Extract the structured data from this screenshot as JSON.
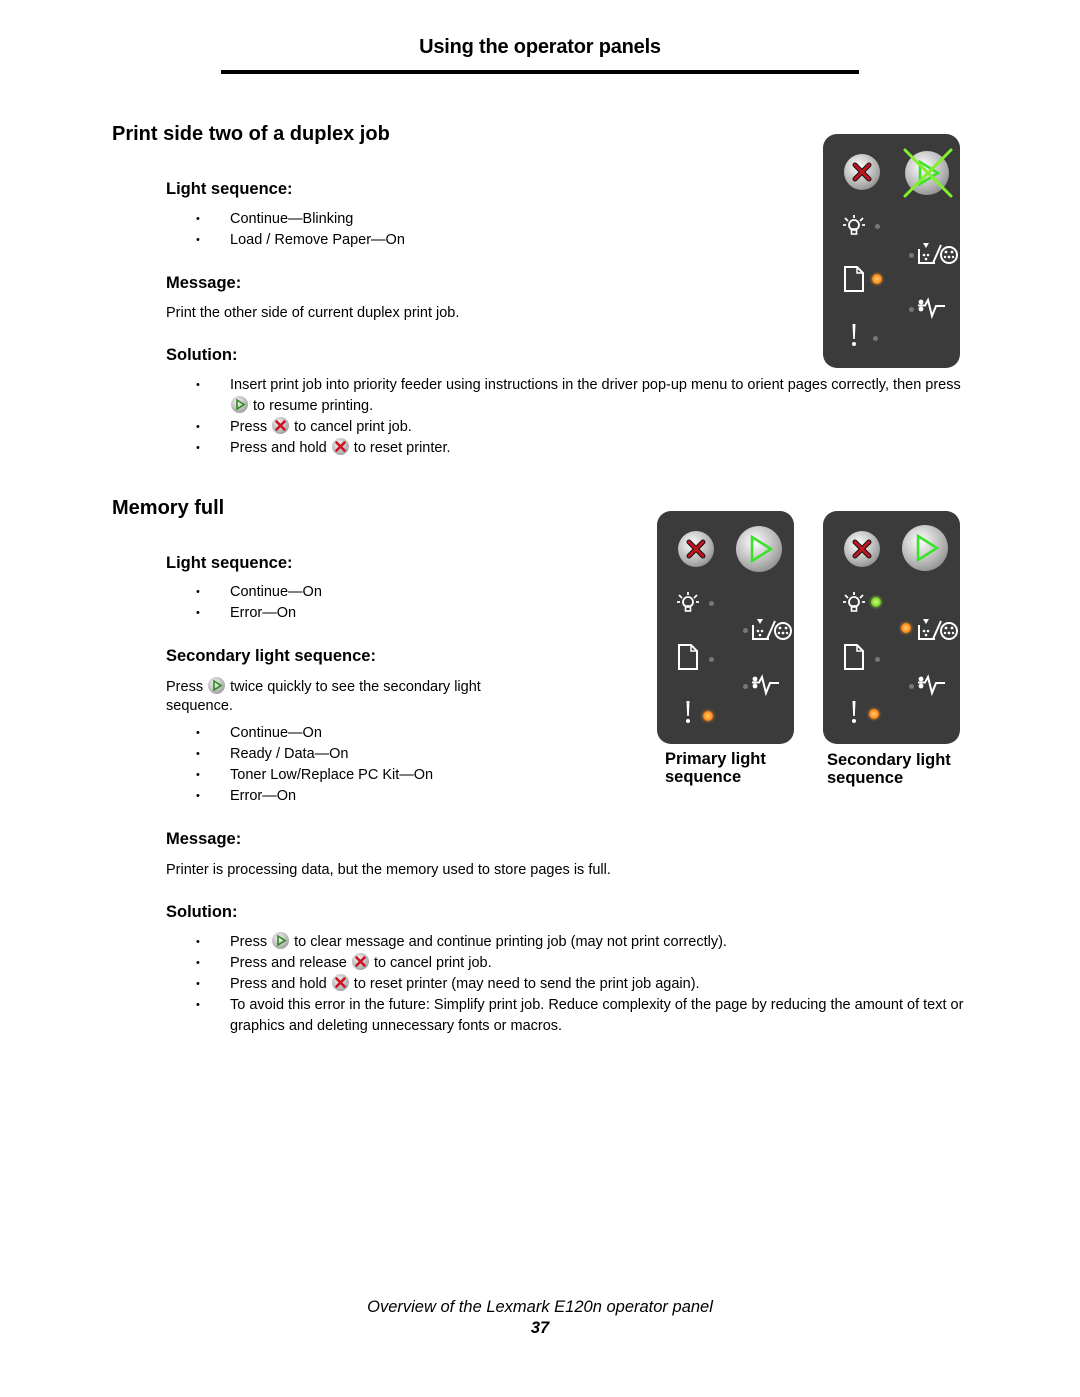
{
  "header": {
    "title": "Using the operator panels"
  },
  "sections": [
    {
      "title": "Print side two of a duplex job",
      "light_sequence": {
        "heading": "Light sequence:",
        "items": [
          "Continue—Blinking",
          "Load / Remove Paper—On"
        ]
      },
      "message": {
        "heading": "Message:",
        "text": "Print the other side of current duplex print job."
      },
      "solution": {
        "heading": "Solution:",
        "items": [
          {
            "before": "Insert print job into priority feeder using instructions in the driver pop-up menu to orient pages correctly, then press",
            "icon": "continue-button-icon",
            "after": "to resume printing."
          },
          {
            "before": "Press",
            "icon": "cancel-button-icon",
            "after": "to cancel print job."
          },
          {
            "before": "Press and hold",
            "icon": "cancel-button-icon",
            "after": "to reset printer."
          }
        ]
      },
      "panel": {
        "continue": "blinking",
        "ready_data": "off",
        "toner_low_replace_pc_kit": "off",
        "load_remove_paper": "on-orange",
        "paper_jam": "off",
        "error": "off"
      }
    },
    {
      "title": "Memory full",
      "light_sequence": {
        "heading": "Light sequence:",
        "items": [
          "Continue—On",
          "Error—On"
        ]
      },
      "secondary_light_sequence": {
        "heading": "Secondary light sequence:",
        "intro_before": "Press",
        "intro_icon": "continue-button-icon",
        "intro_after": "twice quickly to see the secondary light sequence.",
        "items": [
          "Continue—On",
          "Ready / Data—On",
          "Toner Low/Replace PC Kit—On",
          "Error—On"
        ]
      },
      "message": {
        "heading": "Message:",
        "text": "Printer is processing data, but the memory used to store pages is full."
      },
      "solution": {
        "heading": "Solution:",
        "items": [
          {
            "before": "Press",
            "icon": "continue-button-icon",
            "after": "to clear message and continue printing job (may not print correctly)."
          },
          {
            "before": "Press and release",
            "icon": "cancel-button-icon",
            "after": "to cancel print job."
          },
          {
            "before": "Press and hold",
            "icon": "cancel-button-icon",
            "after": "to reset printer (may need to send the print job again)."
          },
          {
            "before": "",
            "icon": "",
            "after": "To avoid this error in the future: Simplify print job. Reduce complexity of the page by reducing the amount of text or graphics and deleting unnecessary fonts or macros."
          }
        ]
      },
      "panels": [
        {
          "caption": "Primary light sequence",
          "continue": "on",
          "ready_data": "off",
          "toner_low_replace_pc_kit": "off",
          "load_remove_paper": "off",
          "paper_jam": "off",
          "error": "on-orange"
        },
        {
          "caption": "Secondary light sequence",
          "continue": "on",
          "ready_data": "on-green",
          "toner_low_replace_pc_kit": "on-orange",
          "load_remove_paper": "off",
          "paper_jam": "off",
          "error": "on-orange"
        }
      ]
    }
  ],
  "footer": {
    "title": "Overview of the Lexmark E120n operator panel",
    "page_number": "37"
  },
  "colors": {
    "panel_bg": "#3b3b3b",
    "led_orange": "#ff8c1a",
    "led_green": "#7fd42a",
    "continue_green": "#33dd22",
    "cancel_red": "#cc1122"
  }
}
